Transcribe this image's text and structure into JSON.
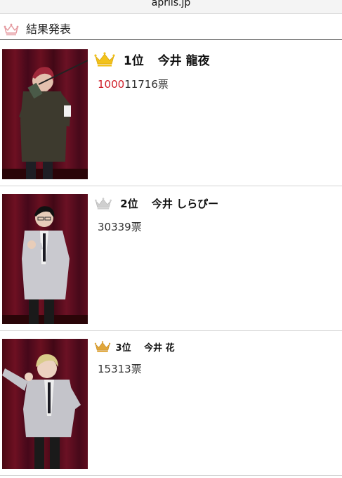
{
  "browser": {
    "url": "aprils.jp"
  },
  "header": {
    "title": "結果発表",
    "icon": "crown-outline-icon",
    "icon_color": "#e59aa0"
  },
  "colors": {
    "crown_gold": "#f2c21a",
    "crown_silver": "#c8c8c8",
    "crown_bronze": "#e0a63a",
    "highlight_red": "#d0202a",
    "curtain": "#5a0d1a"
  },
  "results": [
    {
      "rank": "1位",
      "name": "今井 龍夜",
      "votes_highlight": "1000",
      "votes_rest": "11716票",
      "crown": "gold-crown-icon"
    },
    {
      "rank": "2位",
      "name": "今井 しらぴー",
      "votes": "30339票",
      "crown": "silver-crown-icon"
    },
    {
      "rank": "3位",
      "name": "今井 花",
      "votes": "15313票",
      "crown": "bronze-crown-icon"
    }
  ]
}
